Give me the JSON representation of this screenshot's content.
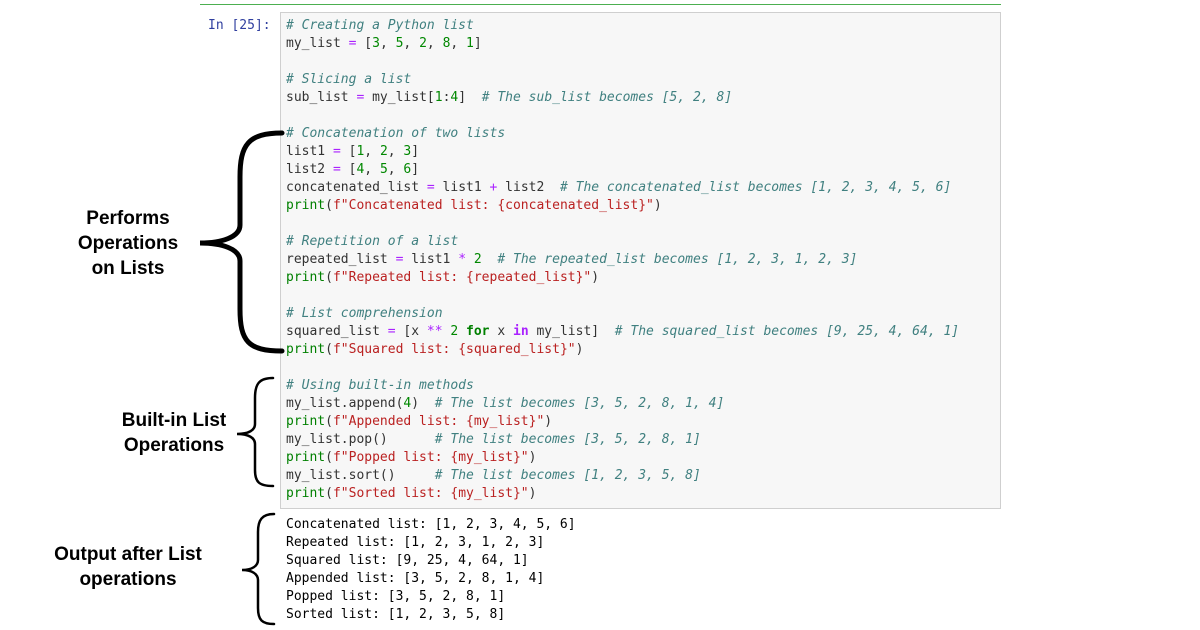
{
  "cell": {
    "prompt": "In [25]:",
    "code": {
      "c1": "# Creating a Python list",
      "c2": "# Slicing a list",
      "c2b": "# The sub_list becomes [5, 2, 8]",
      "c3": "# Concatenation of two lists",
      "c3b": "# The concatenated_list becomes [1, 2, 3, 4, 5, 6]",
      "s1": "f\"Concatenated list: {concatenated_list}\"",
      "c4": "# Repetition of a list",
      "c4b": "# The repeated_list becomes [1, 2, 3, 1, 2, 3]",
      "s2": "f\"Repeated list: {repeated_list}\"",
      "c5": "# List comprehension",
      "c5b": "# The squared_list becomes [9, 25, 4, 64, 1]",
      "s3": "f\"Squared list: {squared_list}\"",
      "c6": "# Using built-in methods",
      "c6a": "# The list becomes [3, 5, 2, 8, 1, 4]",
      "s4": "f\"Appended list: {my_list}\"",
      "c6b": "# The list becomes [3, 5, 2, 8, 1]",
      "s5": "f\"Popped list: {my_list}\"",
      "c6c": "# The list becomes [1, 2, 3, 5, 8]",
      "s6": "f\"Sorted list: {my_list}\""
    },
    "output_lines": [
      "Concatenated list: [1, 2, 3, 4, 5, 6]",
      "Repeated list: [1, 2, 3, 1, 2, 3]",
      "Squared list: [9, 25, 4, 64, 1]",
      "Appended list: [3, 5, 2, 8, 1, 4]",
      "Popped list: [3, 5, 2, 8, 1]",
      "Sorted list: [1, 2, 3, 5, 8]"
    ]
  },
  "annotations": {
    "label1": [
      "Performs",
      "Operations",
      "on Lists"
    ],
    "label2": [
      "Built-in List",
      "Operations"
    ],
    "label3": [
      "Output after List",
      "operations"
    ]
  }
}
